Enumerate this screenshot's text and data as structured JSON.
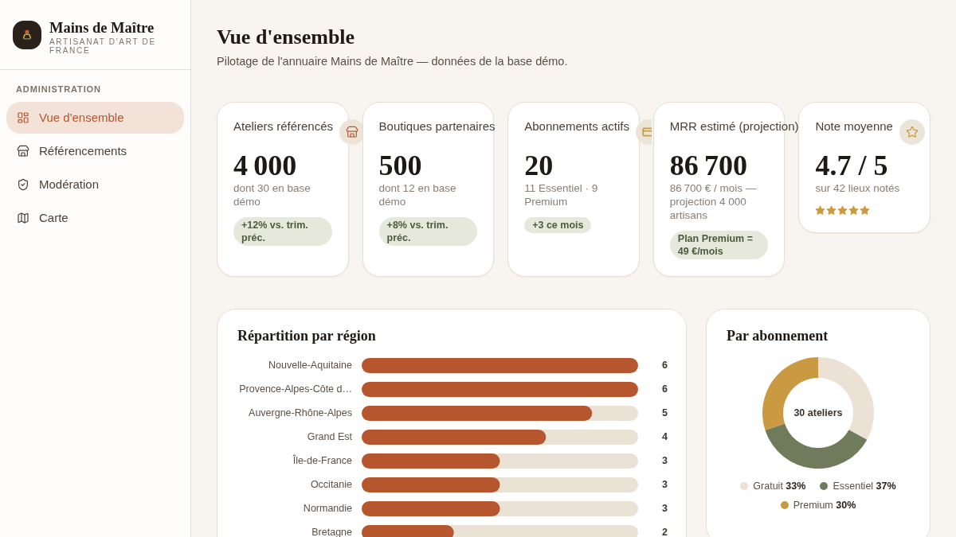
{
  "sidebar": {
    "brand": {
      "name": "Mains de Maître",
      "tagline": "ARTISANAT D'ART DE FRANCE"
    },
    "section_label": "ADMINISTRATION",
    "items": [
      {
        "label": "Vue d'ensemble",
        "selected": true
      },
      {
        "label": "Référencements",
        "selected": false
      },
      {
        "label": "Modération",
        "selected": false
      },
      {
        "label": "Carte",
        "selected": false
      }
    ]
  },
  "header": {
    "title": "Vue d'ensemble",
    "subtitle": "Pilotage de l'annuaire Mains de Maître — données de la base démo."
  },
  "kpi_cards": [
    {
      "kind": "metric",
      "title": "Ateliers référencés",
      "value": "4 000",
      "detail": "dont 30 en base démo",
      "badge": "+12% vs. trim. préc."
    },
    {
      "kind": "metric",
      "title": "Boutiques partenaires",
      "value": "500",
      "detail": "dont 12 en base démo",
      "badge": "+8% vs. trim. préc."
    },
    {
      "kind": "metric",
      "title": "Abonnements actifs",
      "value": "20",
      "detail": "11 Essentiel · 9 Premium",
      "badge": "+3 ce mois"
    },
    {
      "kind": "metric",
      "title": "MRR estimé (projection)",
      "value": "86 700",
      "detail": "86 700 € / mois — projection 4 000 artisans",
      "badge": "Plan Premium = 49 €/mois"
    },
    {
      "kind": "rating",
      "title": "Note moyenne",
      "value": "4.7 / 5",
      "detail": "sur 42 lieux notés",
      "stars": 5
    }
  ],
  "region_panel": {
    "title": "Répartition par région",
    "chart_data": {
      "type": "bar",
      "orientation": "horizontal",
      "categories": [
        "Nouvelle-Aquitaine",
        "Provence-Alpes-Côte d…",
        "Auvergne-Rhône-Alpes",
        "Grand Est",
        "Île-de-France",
        "Occitanie",
        "Normandie",
        "Bretagne"
      ],
      "values": [
        6,
        6,
        5,
        4,
        3,
        3,
        3,
        2
      ],
      "data_labels": true
    }
  },
  "subscription_panel": {
    "title": "Par abonnement",
    "chart_data": {
      "type": "donut",
      "categories": [
        "Gratuit",
        "Essentiel",
        "Premium"
      ],
      "values": [
        33,
        37,
        30
      ],
      "colors": [
        "#ebe2d5",
        "#707b5c",
        "#c99a42"
      ],
      "value_labels": [
        "33%",
        "37%",
        "30%"
      ],
      "legend": "bottom",
      "annotations": [
        {
          "text": "30 ateliers"
        }
      ]
    }
  }
}
